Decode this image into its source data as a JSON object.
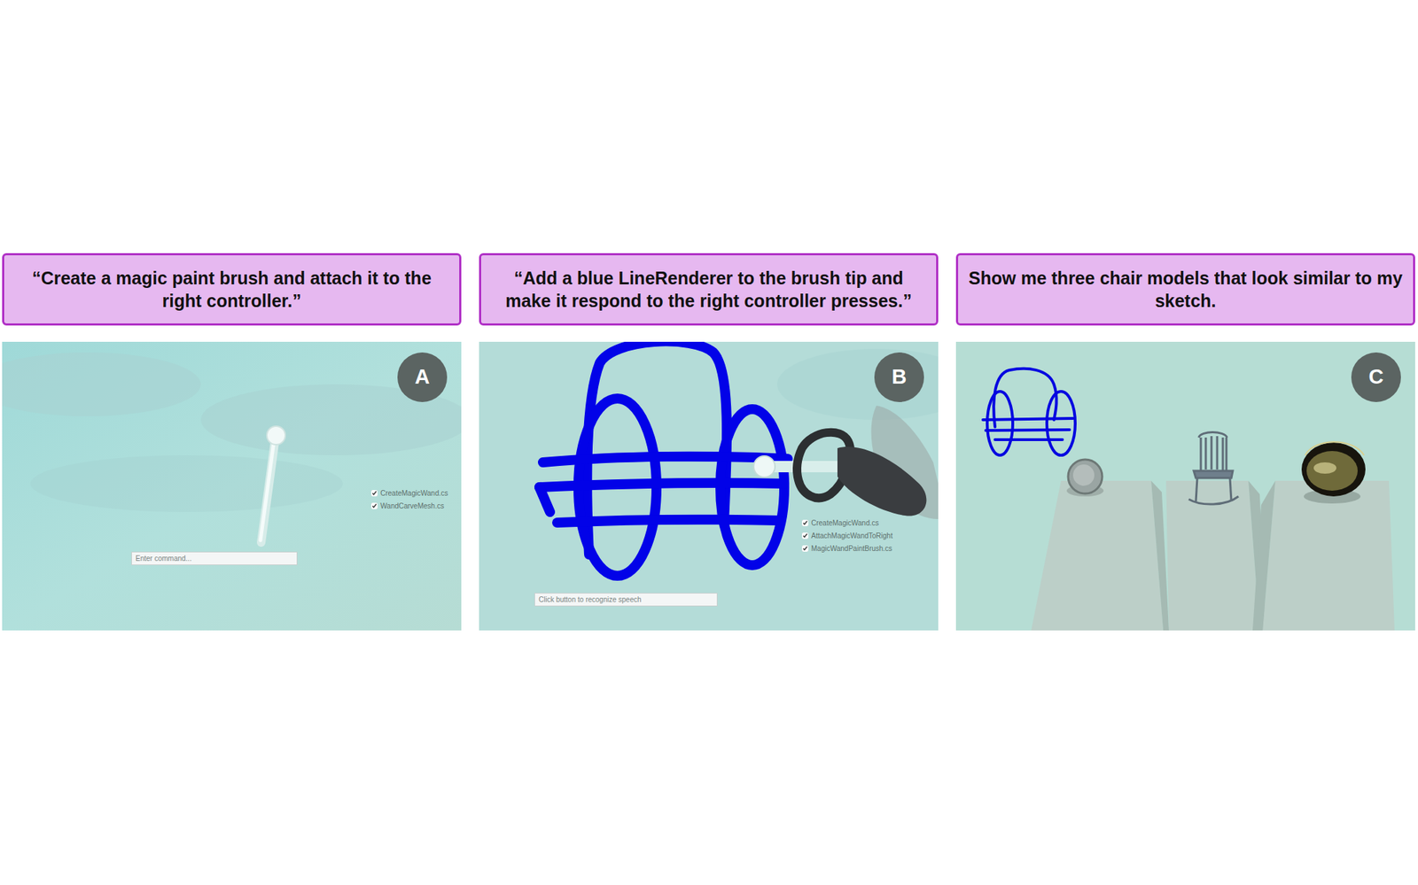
{
  "panels": [
    {
      "badge": "A",
      "caption": "“Create a magic paint brush and attach it to the right controller.”",
      "kind": "wand",
      "scripts": [
        {
          "label": "CreateMagicWand.cs",
          "checked": true
        },
        {
          "label": "WandCarveMesh.cs",
          "checked": true
        }
      ],
      "command": {
        "placeholder": "Enter command..."
      }
    },
    {
      "badge": "B",
      "caption": "“Add a blue LineRenderer to the brush tip and make it respond to the right controller presses.”",
      "kind": "paint",
      "scripts": [
        {
          "label": "CreateMagicWand.cs",
          "checked": true
        },
        {
          "label": "AttachMagicWandToRight",
          "checked": true
        },
        {
          "label": "MagicWandPaintBrush.cs",
          "checked": true
        }
      ],
      "command": {
        "placeholder": "Click button to recognize speech"
      }
    },
    {
      "badge": "C",
      "caption": "Show me three chair models that look similar to my sketch.",
      "kind": "chairs"
    }
  ]
}
